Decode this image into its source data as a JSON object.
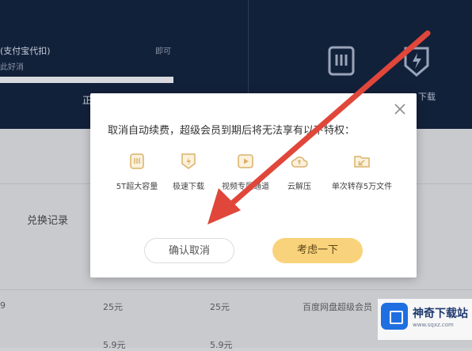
{
  "background": {
    "pay_title": "(支付宝代扣)",
    "pay_sub": "此好消",
    "expired": "即可",
    "truncated_text": "正",
    "download_label": "下载",
    "history_label": "兑换记录",
    "table_rows": [
      {
        "c1": "9",
        "c2": "25元",
        "c3": "25元",
        "c4": "百度网盘超级会员"
      },
      {
        "c1": "",
        "c2": "5.9元",
        "c3": "5.9元",
        "c4": ""
      }
    ]
  },
  "dialog": {
    "message": "取消自动续费，超级会员到期后将无法享有以下特权：",
    "privileges": [
      {
        "icon": "storage-box-icon",
        "label": "5T超大容量"
      },
      {
        "icon": "speed-download-icon",
        "label": "极速下载"
      },
      {
        "icon": "video-play-icon",
        "label": "视频专属通道"
      },
      {
        "icon": "cloud-unzip-icon",
        "label": "云解压"
      },
      {
        "icon": "folder-transfer-icon",
        "label": "单次转存5万文件"
      }
    ],
    "confirm_label": "确认取消",
    "consider_label": "考虑一下"
  },
  "watermark": {
    "name": "神奇下载站",
    "url": "www.sqxz.com"
  },
  "colors": {
    "accent_yellow": "#f9d37b",
    "icon_gold": "#d9b26a",
    "arrow_red": "#e0473a",
    "header_dark": "#12213a"
  }
}
